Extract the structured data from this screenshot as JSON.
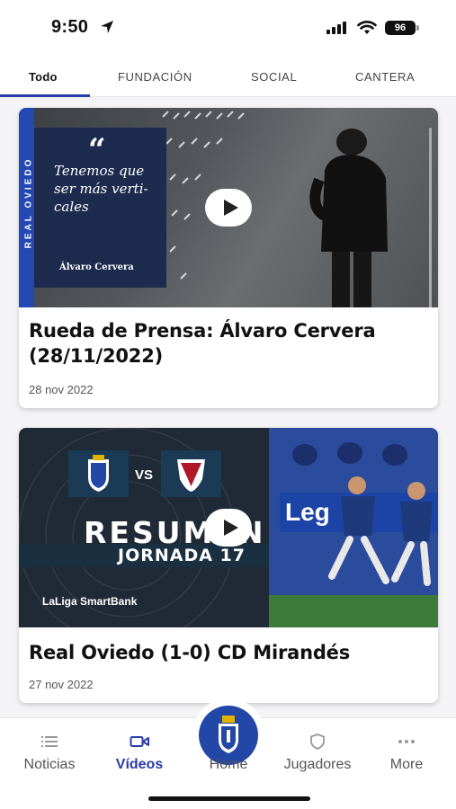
{
  "status": {
    "time": "9:50",
    "battery": "96"
  },
  "tabs": [
    {
      "label": "Todo",
      "active": true
    },
    {
      "label": "FUNDACIÓN",
      "active": false
    },
    {
      "label": "SOCIAL",
      "active": false
    },
    {
      "label": "CANTERA",
      "active": false
    }
  ],
  "videos": [
    {
      "title": "Rueda de Prensa: Álvaro Cervera (28/11/2022)",
      "date": "28 nov 2022",
      "thumbnail": {
        "side_text": "REAL OVIEDO",
        "quote_mark": "“",
        "quote": "Tenemos que ser más verti- cales",
        "author": "Álvaro Cervera"
      }
    },
    {
      "title": "Real Oviedo (1-0) CD Mirandés",
      "date": "27 nov 2022",
      "thumbnail": {
        "vs": "VS",
        "headline": "RESUMEN",
        "subheadline": "JORNADA 17",
        "sponsor": "LaLiga SmartBank",
        "board_text": "Leg"
      }
    }
  ],
  "bottom_nav": [
    {
      "label": "Noticias",
      "icon": "list-icon",
      "active": false
    },
    {
      "label": "Vídeos",
      "icon": "video-camera-icon",
      "active": true
    },
    {
      "label": "Home",
      "icon": "club-crest-icon",
      "active": false
    },
    {
      "label": "Jugadores",
      "icon": "shield-icon",
      "active": false
    },
    {
      "label": "More",
      "icon": "more-dots-icon",
      "active": false
    }
  ],
  "colors": {
    "accent": "#2a3ca7",
    "club_blue": "#2347a6"
  }
}
